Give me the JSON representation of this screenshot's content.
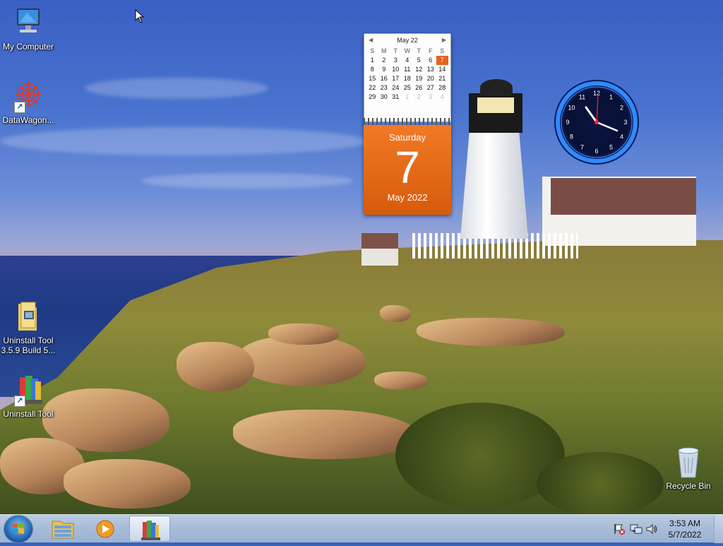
{
  "desktop": {
    "icons": [
      {
        "label": "My Computer",
        "icon": "computer-icon"
      },
      {
        "label": "DataWagon...",
        "icon": "datawagon-icon"
      },
      {
        "label": "Uninstall Tool 3.5.9 Build 5...",
        "icon": "folder-icon"
      },
      {
        "label": "Uninstall Tool",
        "icon": "uninstall-tool-icon"
      },
      {
        "label": "Recycle Bin",
        "icon": "recycle-bin-icon"
      }
    ]
  },
  "calendar_gadget": {
    "month_label": "May 22",
    "weekdays": [
      "S",
      "M",
      "T",
      "W",
      "T",
      "F",
      "S"
    ],
    "days": [
      "1",
      "2",
      "3",
      "4",
      "5",
      "6",
      "7",
      "8",
      "9",
      "10",
      "11",
      "12",
      "13",
      "14",
      "15",
      "16",
      "17",
      "18",
      "19",
      "20",
      "21",
      "22",
      "23",
      "24",
      "25",
      "26",
      "27",
      "28",
      "29",
      "30",
      "31",
      "1",
      "2",
      "3",
      "4"
    ],
    "today": "7",
    "day_of_week": "Saturday",
    "day_number": "7",
    "month_year": "May 2022",
    "accent": "#e8631a"
  },
  "clock_gadget": {
    "numerals": [
      "12",
      "1",
      "2",
      "3",
      "4",
      "5",
      "6",
      "7",
      "8",
      "9",
      "10",
      "11"
    ],
    "ring_color": "#1e6bff"
  },
  "taskbar": {
    "start": "start-button",
    "pinned": [
      {
        "icon": "file-explorer-icon"
      },
      {
        "icon": "media-player-icon"
      },
      {
        "icon": "uninstall-tool-icon",
        "active": true
      }
    ],
    "tray": {
      "time": "3:53 AM",
      "date": "5/7/2022",
      "icons": [
        "action-center-flag-icon",
        "network-icon",
        "speaker-icon"
      ]
    }
  }
}
